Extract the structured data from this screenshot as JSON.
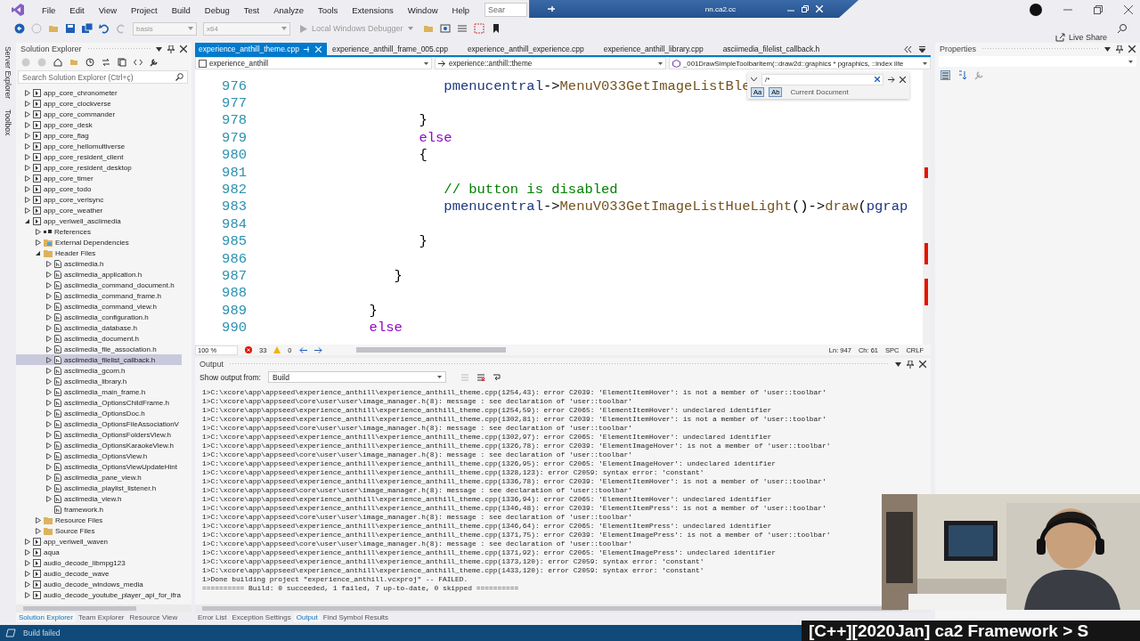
{
  "menu": [
    "File",
    "Edit",
    "View",
    "Project",
    "Build",
    "Debug",
    "Test",
    "Analyze",
    "Tools",
    "Extensions",
    "Window",
    "Help"
  ],
  "search": {
    "placeholder": "Sear"
  },
  "overlay_window": {
    "title": "nn.ca2.cc"
  },
  "toolbar": {
    "configuration": "basis",
    "platform": "x64",
    "debugger": "Local Windows Debugger",
    "live_share": "Live Share"
  },
  "side_strip": [
    "Server Explorer",
    "Toolbox"
  ],
  "solution_explorer": {
    "title": "Solution Explorer",
    "search": {
      "placeholder": "Search Solution Explorer (Ctrl+ç)"
    },
    "tree": [
      {
        "label": "app_core_chronometer",
        "kind": "project",
        "expanded": false,
        "selected": false
      },
      {
        "label": "app_core_clockverse",
        "kind": "project",
        "expanded": false,
        "selected": false
      },
      {
        "label": "app_core_commander",
        "kind": "project",
        "expanded": false,
        "selected": false
      },
      {
        "label": "app_core_desk",
        "kind": "project",
        "expanded": false,
        "selected": false
      },
      {
        "label": "app_core_flag",
        "kind": "project",
        "expanded": false,
        "selected": false
      },
      {
        "label": "app_core_hellomultiverse",
        "kind": "project",
        "expanded": false,
        "selected": false
      },
      {
        "label": "app_core_resident_client",
        "kind": "project",
        "expanded": false,
        "selected": false
      },
      {
        "label": "app_core_resident_desktop",
        "kind": "project",
        "expanded": false,
        "selected": false
      },
      {
        "label": "app_core_timer",
        "kind": "project",
        "expanded": false,
        "selected": false
      },
      {
        "label": "app_core_todo",
        "kind": "project",
        "expanded": false,
        "selected": false
      },
      {
        "label": "app_core_verisync",
        "kind": "project",
        "expanded": false,
        "selected": false
      },
      {
        "label": "app_core_weather",
        "kind": "project",
        "expanded": false,
        "selected": false
      },
      {
        "label": "app_veriwell_asciimedia",
        "kind": "project",
        "expanded": true,
        "selected": false,
        "children": [
          {
            "label": "References",
            "kind": "references",
            "expanded": false,
            "selected": false
          },
          {
            "label": "External Dependencies",
            "kind": "dependencies",
            "expanded": false,
            "selected": false
          },
          {
            "label": "Header Files",
            "kind": "folder",
            "expanded": true,
            "selected": false,
            "children": [
              {
                "label": "asciimedia.h",
                "kind": "header",
                "expanded": false,
                "selected": false
              },
              {
                "label": "asciimedia_application.h",
                "kind": "header",
                "expanded": false,
                "selected": false
              },
              {
                "label": "asciimedia_command_document.h",
                "kind": "header",
                "expanded": false,
                "selected": false
              },
              {
                "label": "asciimedia_command_frame.h",
                "kind": "header",
                "expanded": false,
                "selected": false
              },
              {
                "label": "asciimedia_command_view.h",
                "kind": "header",
                "expanded": false,
                "selected": false
              },
              {
                "label": "asciimedia_configuration.h",
                "kind": "header",
                "expanded": false,
                "selected": false
              },
              {
                "label": "asciimedia_database.h",
                "kind": "header",
                "expanded": false,
                "selected": false
              },
              {
                "label": "asciimedia_document.h",
                "kind": "header",
                "expanded": false,
                "selected": false
              },
              {
                "label": "asciimedia_file_association.h",
                "kind": "header",
                "expanded": false,
                "selected": false
              },
              {
                "label": "asciimedia_filelist_callback.h",
                "kind": "header",
                "expanded": false,
                "selected": true
              },
              {
                "label": "asciimedia_gcom.h",
                "kind": "header",
                "expanded": false,
                "selected": false
              },
              {
                "label": "asciimedia_library.h",
                "kind": "header",
                "expanded": false,
                "selected": false
              },
              {
                "label": "asciimedia_main_frame.h",
                "kind": "header",
                "expanded": false,
                "selected": false
              },
              {
                "label": "asciimedia_OptionsChildFrame.h",
                "kind": "header",
                "expanded": false,
                "selected": false
              },
              {
                "label": "asciimedia_OptionsDoc.h",
                "kind": "header",
                "expanded": false,
                "selected": false
              },
              {
                "label": "asciimedia_OptionsFileAssociationV",
                "kind": "header",
                "expanded": false,
                "selected": false
              },
              {
                "label": "asciimedia_OptionsFoldersView.h",
                "kind": "header",
                "expanded": false,
                "selected": false
              },
              {
                "label": "asciimedia_OptionsKaraokeView.h",
                "kind": "header",
                "expanded": false,
                "selected": false
              },
              {
                "label": "asciimedia_OptionsView.h",
                "kind": "header",
                "expanded": false,
                "selected": false
              },
              {
                "label": "asciimedia_OptionsViewUpdateHint",
                "kind": "header",
                "expanded": false,
                "selected": false
              },
              {
                "label": "asciimedia_pane_view.h",
                "kind": "header",
                "expanded": false,
                "selected": false
              },
              {
                "label": "asciimedia_playlist_listener.h",
                "kind": "header",
                "expanded": false,
                "selected": false
              },
              {
                "label": "asciimedia_view.h",
                "kind": "header",
                "expanded": false,
                "selected": false
              },
              {
                "label": "framework.h",
                "kind": "header",
                "selected": false
              }
            ]
          },
          {
            "label": "Resource Files",
            "kind": "folder",
            "expanded": false,
            "selected": false
          },
          {
            "label": "Source Files",
            "kind": "folder",
            "expanded": false,
            "selected": false
          }
        ]
      },
      {
        "label": "app_veriwell_waven",
        "kind": "project",
        "expanded": false,
        "selected": false
      },
      {
        "label": "aqua",
        "kind": "project",
        "expanded": false,
        "selected": false
      },
      {
        "label": "audio_decode_libmpg123",
        "kind": "project",
        "expanded": false,
        "selected": false
      },
      {
        "label": "audio_decode_wave",
        "kind": "project",
        "expanded": false,
        "selected": false
      },
      {
        "label": "audio_decode_windows_media",
        "kind": "project",
        "expanded": false,
        "selected": false
      },
      {
        "label": "audio_decode_youtube_player_api_for_ifra",
        "kind": "project",
        "expanded": false,
        "selected": false
      }
    ],
    "tabs": [
      {
        "label": "Solution Explorer",
        "selected": true
      },
      {
        "label": "Team Explorer",
        "selected": false
      },
      {
        "label": "Resource View",
        "selected": false
      }
    ]
  },
  "editor": {
    "tabs": [
      {
        "label": "experience_anthill_theme.cpp",
        "selected": true
      },
      {
        "label": "experience_anthill_frame_005.cpp",
        "selected": false
      },
      {
        "label": "experience_anthill_experience.cpp",
        "selected": false
      },
      {
        "label": "experience_anthill_library.cpp",
        "selected": false
      },
      {
        "label": "asciimedia_filelist_callback.h",
        "selected": false
      }
    ],
    "navigation": {
      "project": "experience_anthill",
      "scope": "experience::anthill::theme",
      "member": "_001DrawSimpleToolbarItem(::draw2d::graphics * pgraphics, ::index iIte"
    },
    "code_lines": [
      {
        "number": "976",
        "segments": [
          {
            "kind": "variable",
            "text": "                     pmenucentral"
          },
          {
            "kind": "plain",
            "text": "->"
          },
          {
            "kind": "method",
            "text": "MenuV033GetImageListBle"
          }
        ]
      },
      {
        "number": "977"
      },
      {
        "number": "978",
        "segments": [
          {
            "kind": "plain",
            "text": "                  }"
          }
        ]
      },
      {
        "number": "979",
        "segments": [
          {
            "kind": "keyword",
            "text": "                  else"
          }
        ]
      },
      {
        "number": "980",
        "segments": [
          {
            "kind": "plain",
            "text": "                  {"
          }
        ]
      },
      {
        "number": "981"
      },
      {
        "number": "982",
        "segments": [
          {
            "kind": "comment",
            "text": "                     // button is disabled"
          }
        ]
      },
      {
        "number": "983",
        "segments": [
          {
            "kind": "variable",
            "text": "                     pmenucentral"
          },
          {
            "kind": "plain",
            "text": "->"
          },
          {
            "kind": "method",
            "text": "MenuV033GetImageListHueLight"
          },
          {
            "kind": "plain",
            "text": "()->"
          },
          {
            "kind": "method",
            "text": "draw"
          },
          {
            "kind": "plain",
            "text": "("
          },
          {
            "kind": "variable",
            "text": "pgrap"
          }
        ]
      },
      {
        "number": "984"
      },
      {
        "number": "985",
        "segments": [
          {
            "kind": "plain",
            "text": "                  }"
          }
        ]
      },
      {
        "number": "986"
      },
      {
        "number": "987",
        "segments": [
          {
            "kind": "plain",
            "text": "               }"
          }
        ]
      },
      {
        "number": "988"
      },
      {
        "number": "989",
        "segments": [
          {
            "kind": "plain",
            "text": "            }"
          }
        ]
      },
      {
        "number": "990",
        "segments": [
          {
            "kind": "keyword",
            "text": "            else"
          }
        ]
      }
    ],
    "find": {
      "value": "/*",
      "match_case": "Aa",
      "whole_word": "Ab",
      "scope": "Current Document"
    },
    "status": {
      "zoom": "100 %",
      "errors": "33",
      "warnings": "0",
      "line": "Ln: 947",
      "column": "Ch: 61",
      "indent": "SPC",
      "line_ending": "CRLF"
    }
  },
  "output": {
    "title": "Output",
    "source_label": "Show output from:",
    "source": "Build",
    "lines": [
      "1>C:\\xcore\\app\\appseed\\experience_anthill\\experience_anthill_theme.cpp(1254,43): error C2039: 'ElementItemHover': is not a member of 'user::toolbar'",
      "1>C:\\xcore\\app\\appseed\\core\\user\\user\\image_manager.h(8): message : see declaration of 'user::toolbar'",
      "1>C:\\xcore\\app\\appseed\\experience_anthill\\experience_anthill_theme.cpp(1254,59): error C2065: 'ElementItemHover': undeclared identifier",
      "1>C:\\xcore\\app\\appseed\\experience_anthill\\experience_anthill_theme.cpp(1302,81): error C2039: 'ElementItemHover': is not a member of 'user::toolbar'",
      "1>C:\\xcore\\app\\appseed\\core\\user\\user\\image_manager.h(8): message : see declaration of 'user::toolbar'",
      "1>C:\\xcore\\app\\appseed\\experience_anthill\\experience_anthill_theme.cpp(1302,97): error C2065: 'ElementItemHover': undeclared identifier",
      "1>C:\\xcore\\app\\appseed\\experience_anthill\\experience_anthill_theme.cpp(1326,78): error C2039: 'ElementImageHover': is not a member of 'user::toolbar'",
      "1>C:\\xcore\\app\\appseed\\core\\user\\user\\image_manager.h(8): message : see declaration of 'user::toolbar'",
      "1>C:\\xcore\\app\\appseed\\experience_anthill\\experience_anthill_theme.cpp(1326,95): error C2065: 'ElementImageHover': undeclared identifier",
      "1>C:\\xcore\\app\\appseed\\experience_anthill\\experience_anthill_theme.cpp(1328,123): error C2059: syntax error: 'constant'",
      "1>C:\\xcore\\app\\appseed\\experience_anthill\\experience_anthill_theme.cpp(1336,78): error C2039: 'ElementItemHover': is not a member of 'user::toolbar'",
      "1>C:\\xcore\\app\\appseed\\core\\user\\user\\image_manager.h(8): message : see declaration of 'user::toolbar'",
      "1>C:\\xcore\\app\\appseed\\experience_anthill\\experience_anthill_theme.cpp(1336,94): error C2065: 'ElementItemHover': undeclared identifier",
      "1>C:\\xcore\\app\\appseed\\experience_anthill\\experience_anthill_theme.cpp(1346,48): error C2039: 'ElementItemPress': is not a member of 'user::toolbar'",
      "1>C:\\xcore\\app\\appseed\\core\\user\\user\\image_manager.h(8): message : see declaration of 'user::toolbar'",
      "1>C:\\xcore\\app\\appseed\\experience_anthill\\experience_anthill_theme.cpp(1346,64): error C2065: 'ElementItemPress': undeclared identifier",
      "1>C:\\xcore\\app\\appseed\\experience_anthill\\experience_anthill_theme.cpp(1371,75): error C2039: 'ElementImagePress': is not a member of 'user::toolbar'",
      "1>C:\\xcore\\app\\appseed\\core\\user\\user\\image_manager.h(8): message : see declaration of 'user::toolbar'",
      "1>C:\\xcore\\app\\appseed\\experience_anthill\\experience_anthill_theme.cpp(1371,92): error C2065: 'ElementImagePress': undeclared identifier",
      "1>C:\\xcore\\app\\appseed\\experience_anthill\\experience_anthill_theme.cpp(1373,120): error C2059: syntax error: 'constant'",
      "1>C:\\xcore\\app\\appseed\\experience_anthill\\experience_anthill_theme.cpp(1433,120): error C2059: syntax error: 'constant'",
      "1>Done building project \"experience_anthill.vcxproj\" -- FAILED.",
      "========== Build: 0 succeeded, 1 failed, 7 up-to-date, 0 skipped =========="
    ],
    "tabs": [
      {
        "label": "Error List",
        "selected": false
      },
      {
        "label": "Exception Settings",
        "selected": false
      },
      {
        "label": "Output",
        "selected": true
      },
      {
        "label": "Find Symbol Results",
        "selected": false
      }
    ]
  },
  "properties": {
    "title": "Properties"
  },
  "status_bar": {
    "message": "Build failed"
  },
  "caption": "[C++][2020Jan] ca2 Framework > S",
  "webcam": {
    "kind": "picture"
  }
}
